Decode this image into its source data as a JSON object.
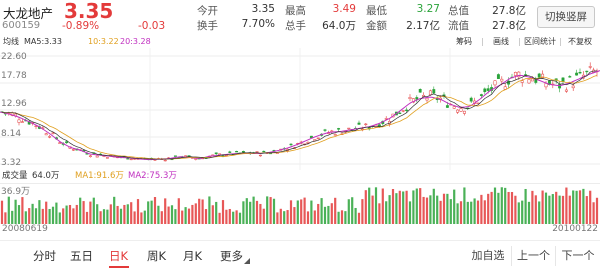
{
  "quote": {
    "name": "大龙地产",
    "code": "600159",
    "price": "3.35",
    "change_pct": "-0.89%",
    "change": "-0.03",
    "stats": [
      {
        "label": "今开",
        "value": "3.35"
      },
      {
        "label": "换手",
        "value": "7.70%"
      },
      {
        "label": "最高",
        "value": "3.49"
      },
      {
        "label": "总手",
        "value": "64.0万"
      },
      {
        "label": "最低",
        "value": "3.27"
      },
      {
        "label": "金额",
        "value": "2.17亿"
      },
      {
        "label": "总值",
        "value": "27.8亿"
      },
      {
        "label": "流值",
        "value": "27.8亿"
      }
    ],
    "switch_label": "切换竖屏"
  },
  "toolbar": {
    "ma_label": "均线",
    "ma5": "MA5:3.33",
    "ma10": "10:3.22",
    "ma20": "20:3.28",
    "buttons": [
      "筹码",
      "画线",
      "区间统计",
      "不复权"
    ]
  },
  "main_axis": [
    "22.60",
    "17.78",
    "12.96",
    "8.14",
    "3.32"
  ],
  "volume": {
    "label": "成交量",
    "value": "64.0万",
    "ma1": "MA1:91.6万",
    "ma2": "MA2:75.3万",
    "axis_top": "36.9万"
  },
  "dates": {
    "start": "20080619",
    "end": "20100122"
  },
  "tabs": [
    "分时",
    "五日",
    "日K",
    "周K",
    "月K",
    "更多"
  ],
  "active_tab": "日K",
  "actions": [
    "加自选",
    "上一个",
    "下一个"
  ],
  "colors": {
    "up": "#e33a3a",
    "down": "#2aa33a",
    "ma5": "#333333",
    "ma10": "#e0a020",
    "ma20": "#c030c0",
    "accent": "#e33a3a"
  },
  "icons": {
    "more_dropdown": "triangle-down-icon"
  },
  "chart_data": {
    "type": "line",
    "title": "",
    "xlabel": "",
    "ylabel": "",
    "x_range": [
      "20080619",
      "20100122"
    ],
    "ylim": [
      3.32,
      22.6
    ],
    "y_ticks": [
      22.6,
      17.78,
      12.96,
      8.14,
      3.32
    ],
    "series": [
      {
        "name": "MA20",
        "x": [
          0,
          10,
          20,
          30,
          40,
          50,
          60,
          70,
          80,
          90,
          100,
          110,
          120,
          130,
          140,
          150,
          160,
          170,
          180,
          190,
          200,
          210,
          220,
          230,
          240,
          250,
          260,
          270,
          280,
          290,
          300,
          310,
          320,
          330,
          340,
          350,
          360,
          370,
          380,
          390,
          400,
          410,
          420,
          430,
          440,
          450,
          460,
          470,
          480,
          490,
          500,
          510,
          520,
          530,
          540,
          550,
          560,
          570,
          580,
          590,
          600
        ],
        "values": [
          12.6,
          12.2,
          11.6,
          10.8,
          9.9,
          8.7,
          7.3,
          6.3,
          5.8,
          5.1,
          4.9,
          4.7,
          4.5,
          4.4,
          4.2,
          4.1,
          4.2,
          4.3,
          4.6,
          4.5,
          4.3,
          4.7,
          4.9,
          5.1,
          5.2,
          5.2,
          5.2,
          5.4,
          5.8,
          6.3,
          7.0,
          7.8,
          8.5,
          9.0,
          9.1,
          9.4,
          9.7,
          10.0,
          10.6,
          11.5,
          12.8,
          14.2,
          15.0,
          15.3,
          14.9,
          14.0,
          13.4,
          13.6,
          14.9,
          16.4,
          17.4,
          18.6,
          19.2,
          18.8,
          18.2,
          17.5,
          17.3,
          17.8,
          18.6,
          19.4,
          20.0
        ]
      }
    ]
  }
}
